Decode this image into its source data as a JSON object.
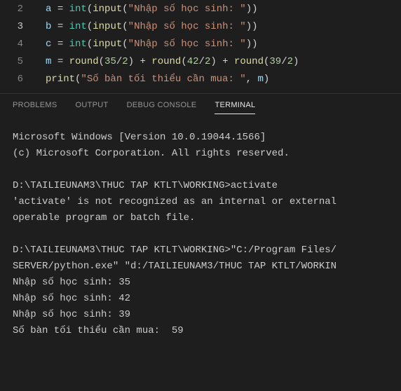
{
  "editor": {
    "lines": [
      {
        "no": "2",
        "hl": false,
        "tokens": [
          {
            "t": "a",
            "c": "tok-var"
          },
          {
            "t": " ",
            "c": "tok-op"
          },
          {
            "t": "=",
            "c": "tok-op"
          },
          {
            "t": " ",
            "c": "tok-op"
          },
          {
            "t": "int",
            "c": "tok-builtin"
          },
          {
            "t": "(",
            "c": "tok-punc"
          },
          {
            "t": "input",
            "c": "tok-fn"
          },
          {
            "t": "(",
            "c": "tok-punc"
          },
          {
            "t": "\"Nhập số học sinh: \"",
            "c": "tok-str"
          },
          {
            "t": ")",
            "c": "tok-punc"
          },
          {
            "t": ")",
            "c": "tok-punc"
          }
        ]
      },
      {
        "no": "3",
        "hl": true,
        "tokens": [
          {
            "t": "b",
            "c": "tok-var"
          },
          {
            "t": " ",
            "c": "tok-op"
          },
          {
            "t": "=",
            "c": "tok-op"
          },
          {
            "t": " ",
            "c": "tok-op"
          },
          {
            "t": "int",
            "c": "tok-builtin"
          },
          {
            "t": "(",
            "c": "tok-punc"
          },
          {
            "t": "input",
            "c": "tok-fn"
          },
          {
            "t": "(",
            "c": "tok-punc"
          },
          {
            "t": "\"Nhập số học sinh: \"",
            "c": "tok-str"
          },
          {
            "t": ")",
            "c": "tok-punc"
          },
          {
            "t": ")",
            "c": "tok-punc"
          }
        ]
      },
      {
        "no": "4",
        "hl": false,
        "tokens": [
          {
            "t": "c",
            "c": "tok-var"
          },
          {
            "t": " ",
            "c": "tok-op"
          },
          {
            "t": "=",
            "c": "tok-op"
          },
          {
            "t": " ",
            "c": "tok-op"
          },
          {
            "t": "int",
            "c": "tok-builtin"
          },
          {
            "t": "(",
            "c": "tok-punc"
          },
          {
            "t": "input",
            "c": "tok-fn"
          },
          {
            "t": "(",
            "c": "tok-punc"
          },
          {
            "t": "\"Nhập số học sinh: \"",
            "c": "tok-str"
          },
          {
            "t": ")",
            "c": "tok-punc"
          },
          {
            "t": ")",
            "c": "tok-punc"
          }
        ]
      },
      {
        "no": "5",
        "hl": false,
        "tokens": [
          {
            "t": "m",
            "c": "tok-var"
          },
          {
            "t": " ",
            "c": "tok-op"
          },
          {
            "t": "=",
            "c": "tok-op"
          },
          {
            "t": " ",
            "c": "tok-op"
          },
          {
            "t": "round",
            "c": "tok-fn"
          },
          {
            "t": "(",
            "c": "tok-punc"
          },
          {
            "t": "35",
            "c": "tok-num"
          },
          {
            "t": "/",
            "c": "tok-op"
          },
          {
            "t": "2",
            "c": "tok-num"
          },
          {
            "t": ")",
            "c": "tok-punc"
          },
          {
            "t": " ",
            "c": "tok-op"
          },
          {
            "t": "+",
            "c": "tok-op"
          },
          {
            "t": " ",
            "c": "tok-op"
          },
          {
            "t": "round",
            "c": "tok-fn"
          },
          {
            "t": "(",
            "c": "tok-punc"
          },
          {
            "t": "42",
            "c": "tok-num"
          },
          {
            "t": "/",
            "c": "tok-op"
          },
          {
            "t": "2",
            "c": "tok-num"
          },
          {
            "t": ")",
            "c": "tok-punc"
          },
          {
            "t": " ",
            "c": "tok-op"
          },
          {
            "t": "+",
            "c": "tok-op"
          },
          {
            "t": " ",
            "c": "tok-op"
          },
          {
            "t": "round",
            "c": "tok-fn"
          },
          {
            "t": "(",
            "c": "tok-punc"
          },
          {
            "t": "39",
            "c": "tok-num"
          },
          {
            "t": "/",
            "c": "tok-op"
          },
          {
            "t": "2",
            "c": "tok-num"
          },
          {
            "t": ")",
            "c": "tok-punc"
          }
        ]
      },
      {
        "no": "6",
        "hl": false,
        "tokens": [
          {
            "t": "print",
            "c": "tok-fn"
          },
          {
            "t": "(",
            "c": "tok-punc"
          },
          {
            "t": "\"Số bàn tối thiểu cần mua: \"",
            "c": "tok-str"
          },
          {
            "t": ",",
            "c": "tok-punc"
          },
          {
            "t": " ",
            "c": "tok-op"
          },
          {
            "t": "m",
            "c": "tok-var"
          },
          {
            "t": ")",
            "c": "tok-punc"
          }
        ]
      }
    ]
  },
  "panel": {
    "tabs": {
      "problems": "PROBLEMS",
      "output": "OUTPUT",
      "debug": "DEBUG CONSOLE",
      "terminal": "TERMINAL"
    }
  },
  "terminal": {
    "lines": [
      "Microsoft Windows [Version 10.0.19044.1566]",
      "(c) Microsoft Corporation. All rights reserved.",
      "",
      "D:\\TAILIEUNAM3\\THUC TAP KTLT\\WORKING>activate",
      "'activate' is not recognized as an internal or external",
      "operable program or batch file.",
      "",
      "D:\\TAILIEUNAM3\\THUC TAP KTLT\\WORKING>\"C:/Program Files/",
      "SERVER/python.exe\" \"d:/TAILIEUNAM3/THUC TAP KTLT/WORKIN",
      "Nhập số học sinh: 35",
      "Nhập số học sinh: 42",
      "Nhập số học sinh: 39",
      "Số bàn tối thiểu cần mua:  59"
    ]
  }
}
